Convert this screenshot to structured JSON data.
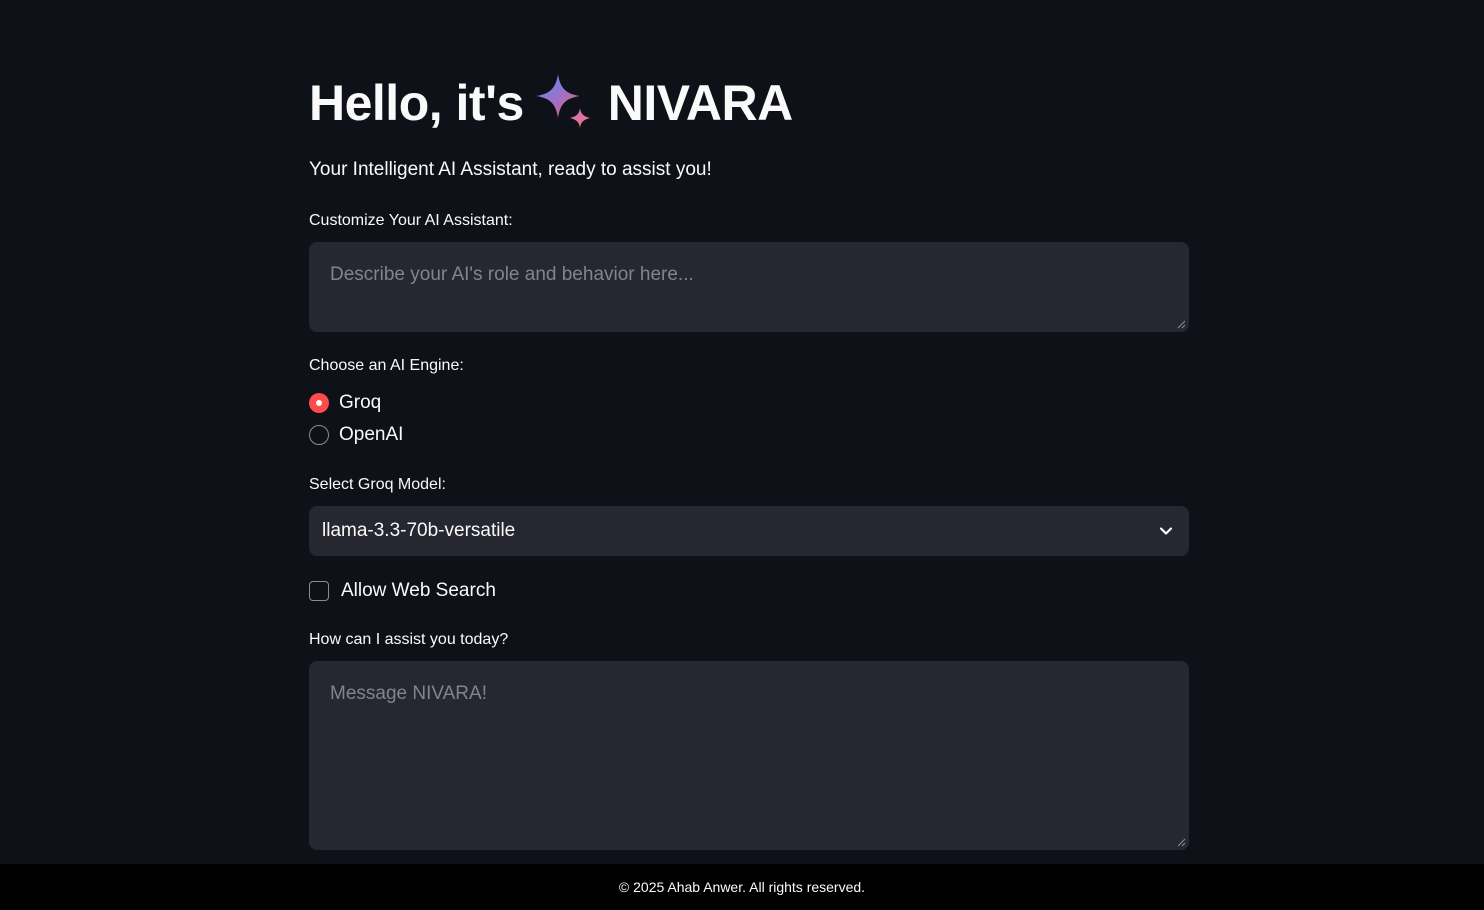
{
  "header": {
    "title_prefix": "Hello, it's",
    "title_name": "NIVARA",
    "subtitle": "Your Intelligent AI Assistant, ready to assist you!"
  },
  "customize": {
    "label": "Customize Your AI Assistant:",
    "placeholder": "Describe your AI's role and behavior here..."
  },
  "engine": {
    "label": "Choose an AI Engine:",
    "options": [
      {
        "label": "Groq",
        "selected": true
      },
      {
        "label": "OpenAI",
        "selected": false
      }
    ]
  },
  "model": {
    "label": "Select Groq Model:",
    "value": "llama-3.3-70b-versatile"
  },
  "web_search": {
    "label": "Allow Web Search",
    "checked": false
  },
  "message": {
    "label": "How can I assist you today?",
    "placeholder": "Message NIVARA!"
  },
  "footer": {
    "text": "© 2025 Ahab Anwer. All rights reserved."
  },
  "colors": {
    "background": "#0e1117",
    "input_bg": "#262730",
    "accent": "#ff4b4b",
    "footer_bg": "#000000"
  },
  "icons": {
    "sparkle": "sparkle-icon",
    "chevron": "chevron-down-icon"
  }
}
